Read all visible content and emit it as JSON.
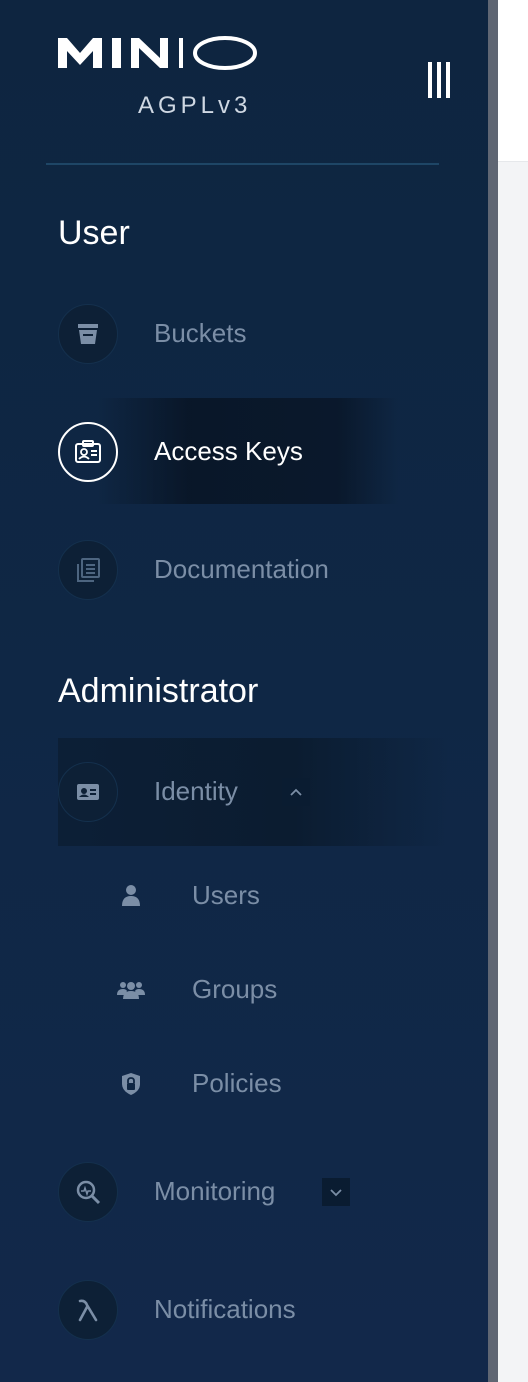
{
  "brand": {
    "logo_text": "MINIO",
    "license": "AGPLv3"
  },
  "sections": {
    "user_title": "User",
    "admin_title": "Administrator"
  },
  "nav": {
    "buckets": "Buckets",
    "access_keys": "Access Keys",
    "documentation": "Documentation",
    "identity": "Identity",
    "users": "Users",
    "groups": "Groups",
    "policies": "Policies",
    "monitoring": "Monitoring",
    "notifications": "Notifications"
  },
  "active_item": "Access Keys",
  "identity_expanded": true,
  "monitoring_expanded": false,
  "icons": {
    "buckets": "bucket-icon",
    "access_keys": "id-card-icon",
    "documentation": "documents-icon",
    "identity": "id-badge-icon",
    "users": "user-icon",
    "groups": "group-icon",
    "policies": "shield-lock-icon",
    "monitoring": "magnifier-chart-icon",
    "notifications": "lambda-icon"
  },
  "colors": {
    "sidebar_bg": "#0f2643",
    "text_active": "#ffffff",
    "text_inactive": "#7b8ea6",
    "accent_divider": "#1e4666"
  }
}
